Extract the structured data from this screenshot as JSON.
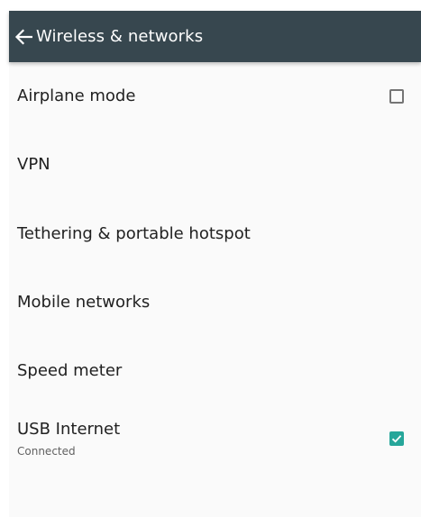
{
  "app_bar": {
    "title": "Wireless & networks",
    "background": "#37474f",
    "back_icon": "arrow-left-icon"
  },
  "settings": [
    {
      "id": "airplane",
      "title": "Airplane mode",
      "summary": "",
      "checkbox": true,
      "checked": false
    },
    {
      "id": "vpn",
      "title": "VPN",
      "summary": "",
      "checkbox": false
    },
    {
      "id": "tethering",
      "title": "Tethering & portable hotspot",
      "summary": "",
      "checkbox": false
    },
    {
      "id": "mobile",
      "title": "Mobile networks",
      "summary": "",
      "checkbox": false
    },
    {
      "id": "speed",
      "title": "Speed meter",
      "summary": "",
      "checkbox": false
    },
    {
      "id": "usb",
      "title": "USB Internet",
      "summary": "Connected",
      "checkbox": true,
      "checked": true
    }
  ],
  "colors": {
    "accent": "#26a69a",
    "list_background": "#fafafa",
    "text_primary": "#212121",
    "text_secondary": "#616161"
  }
}
